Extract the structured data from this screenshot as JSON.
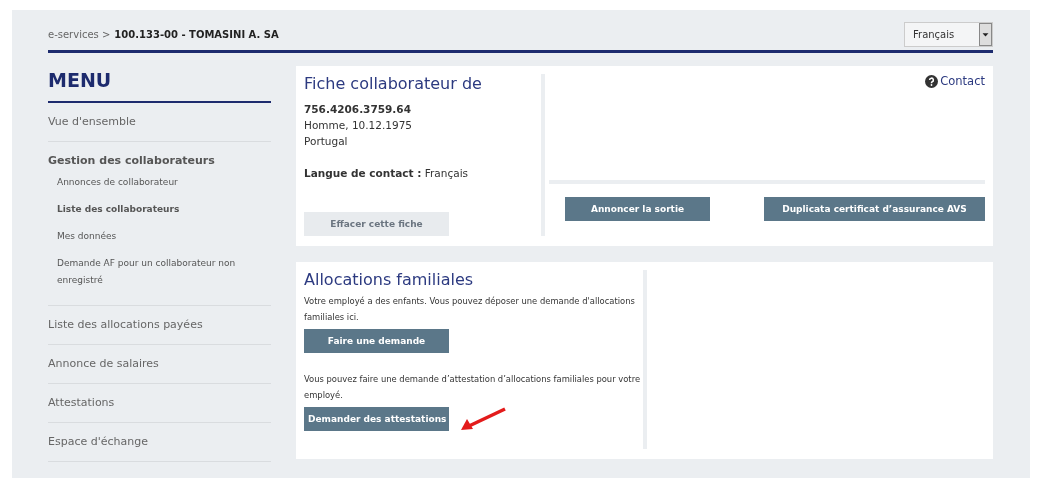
{
  "breadcrumb": {
    "root": "e-services >",
    "current": "100.133-00 - TOMASINI A. SA"
  },
  "language_select": {
    "value": "Français"
  },
  "menu": {
    "title": "MENU",
    "items": [
      {
        "label": "Vue d'ensemble",
        "expanded": false
      },
      {
        "label": "Gestion des collaborateurs",
        "expanded": true,
        "children": [
          {
            "label": "Annonces de collaborateur",
            "selected": false
          },
          {
            "label": "Liste des collaborateurs",
            "selected": true
          },
          {
            "label": "Mes données",
            "selected": false
          },
          {
            "label": "Demande AF pour un collaborateur non enregistré",
            "selected": false
          }
        ]
      },
      {
        "label": "Liste des allocations payées",
        "expanded": false
      },
      {
        "label": "Annonce de salaires",
        "expanded": false
      },
      {
        "label": "Attestations",
        "expanded": false
      },
      {
        "label": "Espace d'échange",
        "expanded": false
      }
    ]
  },
  "employee_card": {
    "title": "Fiche collaborateur de",
    "contact_link": "Contact",
    "avs_number": "756.4206.3759.64",
    "details": [
      "Homme, 10.12.1975",
      "Portugal"
    ],
    "language_label": "Langue de contact :",
    "language_value": "Français",
    "buttons": [
      {
        "label": "Effacer cette fiche",
        "disabled": true
      },
      {
        "label": "Annoncer la sortie",
        "disabled": false
      },
      {
        "label": "Duplicata certificat d’assurance AVS",
        "disabled": false
      }
    ]
  },
  "family_card": {
    "title": "Allocations familiales",
    "sections": [
      {
        "text": "Votre employé a des enfants. Vous pouvez déposer une demande d'allocations familiales ici.",
        "button": "Faire une demande",
        "highlighted": false
      },
      {
        "text": "Vous pouvez faire une demande d’attestation d’allocations familiales pour votre employé.",
        "button": "Demander des attestations",
        "highlighted": true
      }
    ]
  }
}
